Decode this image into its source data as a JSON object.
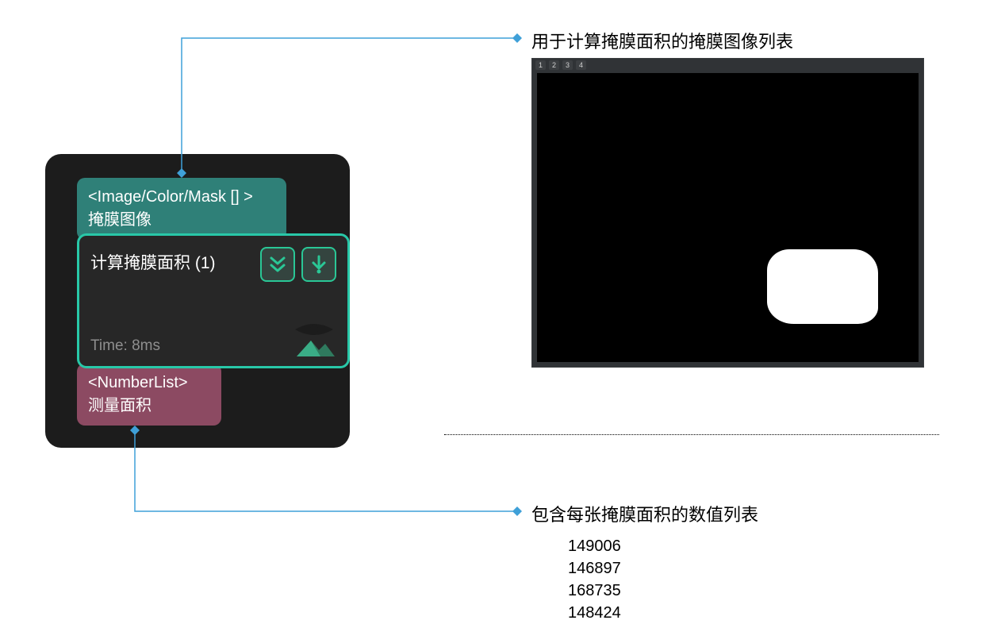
{
  "annotations": {
    "top": "用于计算掩膜面积的掩膜图像列表",
    "bottom_title": "包含每张掩膜面积的数值列表"
  },
  "mask_preview": {
    "tabs": [
      "1",
      "2",
      "3",
      "4"
    ]
  },
  "node": {
    "input": {
      "type_label": "<Image/Color/Mask [] >",
      "name": "掩膜图像"
    },
    "title": "计算掩膜面积 (1)",
    "time_label": "Time: 8ms",
    "output": {
      "type_label": "<NumberList>",
      "name": "测量面积"
    }
  },
  "values": [
    "149006",
    "146897",
    "168735",
    "148424"
  ]
}
